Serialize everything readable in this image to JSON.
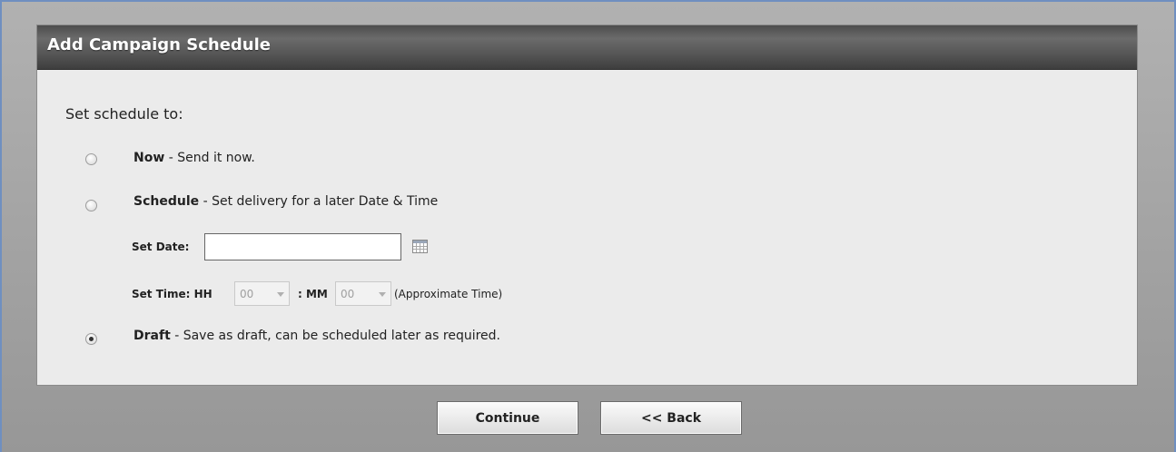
{
  "panel": {
    "title": "Add Campaign Schedule",
    "prompt": "Set schedule to:"
  },
  "options": [
    {
      "name": "Now",
      "description": " - Send it now.",
      "checked": false
    },
    {
      "name": "Schedule",
      "description": " - Set delivery for a later Date & Time",
      "checked": false
    },
    {
      "name": "Draft",
      "description": " - Save as draft, can be scheduled later as required.",
      "checked": true
    }
  ],
  "schedule_fields": {
    "date_label": "Set Date:",
    "date_value": "",
    "time_label": "Set Time: HH",
    "hh_value": "00",
    "mm_label": ": MM",
    "mm_value": "00",
    "approx_note": "(Approximate Time)"
  },
  "icons": {
    "calendar": "calendar-icon"
  },
  "buttons": {
    "continue": "Continue",
    "back": "<< Back"
  }
}
